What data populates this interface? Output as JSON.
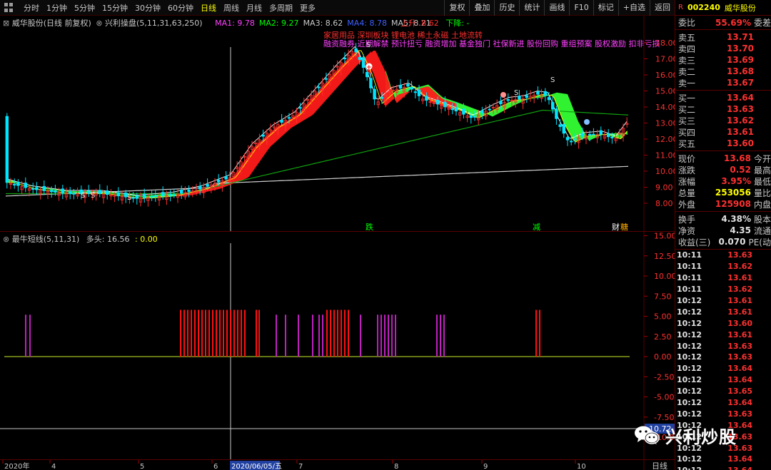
{
  "toolbar": {
    "timeframes": [
      "分时",
      "1分钟",
      "5分钟",
      "15分钟",
      "30分钟",
      "60分钟",
      "日线",
      "周线",
      "月线",
      "多周期",
      "更多"
    ],
    "active_timeframe": "日线",
    "buttons": [
      "复权",
      "叠加",
      "历史",
      "统计",
      "画线",
      "F10",
      "标记",
      "+自选",
      "返回"
    ]
  },
  "main_chart": {
    "stock_label": "威华股份(日线 前复权)",
    "indicator_label": "兴利操盘(5,11,31,63,250)",
    "ma": [
      {
        "name": "MA1:",
        "value": "9.78",
        "color": "#ff40ff"
      },
      {
        "name": "MA2:",
        "value": "9.27",
        "color": "#00ff00"
      },
      {
        "name": "MA3:",
        "value": "8.62",
        "color": "#c8c8c8"
      },
      {
        "name": "MA4:",
        "value": "8.78",
        "color": "#4060ff"
      },
      {
        "name": "MA5:",
        "value": "8.21",
        "color": "#c8c8c8"
      }
    ],
    "up_text": "上升: 8.62",
    "down_text": "下降: -",
    "concepts_line1": "家居用品 深圳板块 锂电池 稀土永磁 土地流转",
    "concepts_line2": "融资融券 近期解禁 预计扭亏 融资增加 基金独门 社保新进 股份回购 重组预案 股权激励 扣非亏损",
    "y_ticks": [
      "18.00",
      "17.00",
      "16.00",
      "15.00",
      "14.00",
      "13.00",
      "12.00",
      "11.00",
      "10.00",
      "9.00",
      "8.00"
    ],
    "markers": {
      "s": "S",
      "die": "跌",
      "jian": "减",
      "cai": "财",
      "fu": "糖"
    }
  },
  "sub_chart": {
    "indicator_label": "最牛短线(5,11,31)",
    "duotou_label": "多头:",
    "duotou_value": "16.56",
    "other_value": ": 0.00",
    "y_ticks": [
      "15.00",
      "12.50",
      "10.00",
      "7.50",
      "5.00",
      "2.50",
      "0.00",
      "-2.50",
      "-5.00",
      "-7.50",
      "-10.00"
    ],
    "cursor_value": "-10.72"
  },
  "xaxis": {
    "labels": [
      "2020年",
      "4",
      "5",
      "6",
      "2020/06/05/五",
      "7",
      "8",
      "9",
      "10"
    ],
    "period": "日线"
  },
  "quote": {
    "badge": "R",
    "code": "002240",
    "name": "威华股份",
    "weibi_label": "委比",
    "weibi_value": "55.69%",
    "weicha_label": "委差",
    "asks": [
      {
        "label": "卖五",
        "price": "13.71"
      },
      {
        "label": "卖四",
        "price": "13.70"
      },
      {
        "label": "卖三",
        "price": "13.69"
      },
      {
        "label": "卖二",
        "price": "13.68"
      },
      {
        "label": "卖一",
        "price": "13.67"
      }
    ],
    "bids": [
      {
        "label": "买一",
        "price": "13.64"
      },
      {
        "label": "买二",
        "price": "13.63"
      },
      {
        "label": "买三",
        "price": "13.62"
      },
      {
        "label": "买四",
        "price": "13.61"
      },
      {
        "label": "买五",
        "price": "13.60"
      }
    ],
    "stats": [
      {
        "label": "现价",
        "value": "13.68",
        "ext": "今开",
        "color": "#ff3030"
      },
      {
        "label": "涨跌",
        "value": "0.52",
        "ext": "最高",
        "color": "#ff3030"
      },
      {
        "label": "涨幅",
        "value": "3.95%",
        "ext": "最低",
        "color": "#ff3030"
      },
      {
        "label": "总量",
        "value": "253056",
        "ext": "量比",
        "color": "#ffff00"
      },
      {
        "label": "外盘",
        "value": "125908",
        "ext": "内盘",
        "color": "#ff3030"
      }
    ],
    "stats2": [
      {
        "label": "换手",
        "value": "4.38%",
        "ext": "股本"
      },
      {
        "label": "净资",
        "value": "4.35",
        "ext": "流通"
      },
      {
        "label": "收益(三)",
        "value": "0.070",
        "ext": "PE(动"
      }
    ],
    "ticks": [
      {
        "time": "10:11",
        "price": "13.63"
      },
      {
        "time": "10:11",
        "price": "13.62"
      },
      {
        "time": "10:11",
        "price": "13.61"
      },
      {
        "time": "10:11",
        "price": "13.62"
      },
      {
        "time": "10:12",
        "price": "13.61"
      },
      {
        "time": "10:12",
        "price": "13.61"
      },
      {
        "time": "10:12",
        "price": "13.60"
      },
      {
        "time": "10:12",
        "price": "13.61"
      },
      {
        "time": "10:12",
        "price": "13.63"
      },
      {
        "time": "10:12",
        "price": "13.63"
      },
      {
        "time": "10:12",
        "price": "13.64"
      },
      {
        "time": "10:12",
        "price": "13.64"
      },
      {
        "time": "10:12",
        "price": "13.65"
      },
      {
        "time": "10:12",
        "price": "13.64"
      },
      {
        "time": "10:12",
        "price": "13.63"
      },
      {
        "time": "10:12",
        "price": "13.64"
      },
      {
        "time": "10:12",
        "price": "13.63"
      },
      {
        "time": "10:12",
        "price": "13.63"
      },
      {
        "time": "10:12",
        "price": "13.64"
      },
      {
        "time": "10:12",
        "price": "13.64"
      }
    ]
  },
  "watermark": {
    "text": "兴利炒股"
  },
  "colors": {
    "up": "#ff3030",
    "down": "#00e5ff",
    "ma_band_up": "#ff1a1a",
    "ma_band_down": "#33ff33",
    "bar_magenta": "#c020c0"
  }
}
